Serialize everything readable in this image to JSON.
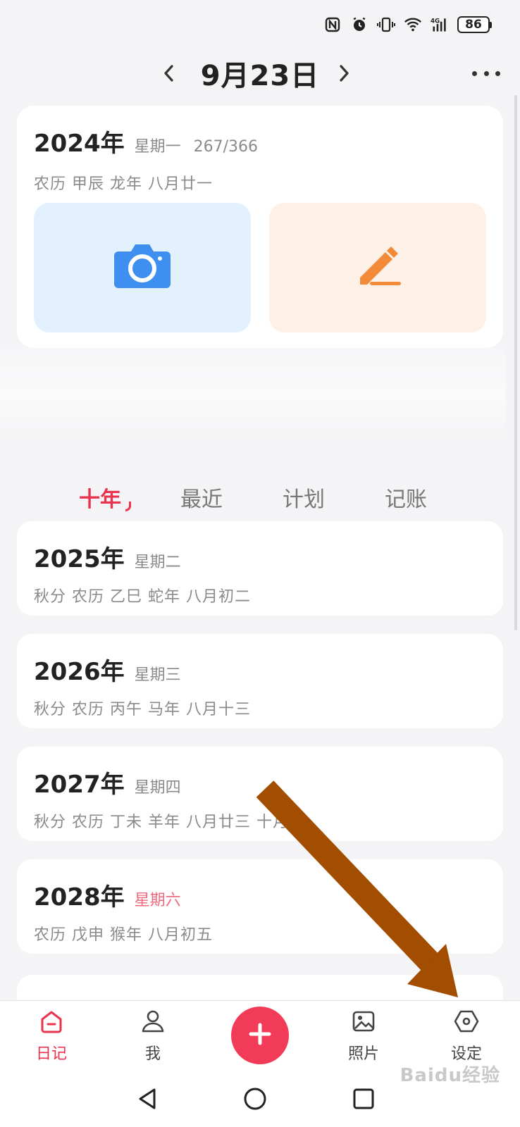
{
  "status_bar": {
    "battery": "86",
    "icons": [
      "nfc-icon",
      "alarm-icon",
      "vibrate-icon",
      "wifi-icon",
      "4g-signal-icon"
    ]
  },
  "header": {
    "title": "9月23日",
    "prev_icon": "chevron-left-icon",
    "next_icon": "chevron-right-icon",
    "more_icon": "more-dots-icon"
  },
  "today": {
    "year": "2024年",
    "weekday": "星期一",
    "day_count": "267/366",
    "lunar": "农历  甲辰 龙年 八月廿一",
    "camera_icon": "camera-icon",
    "write_icon": "pencil-icon"
  },
  "tabs": [
    {
      "label": "十年",
      "active": true
    },
    {
      "label": "最近",
      "active": false
    },
    {
      "label": "计划",
      "active": false
    },
    {
      "label": "记账",
      "active": false
    }
  ],
  "years": [
    {
      "year": "2025年",
      "weekday": "星期二",
      "lunar": "秋分 农历  乙巳 蛇年 八月初二",
      "weekend": false
    },
    {
      "year": "2026年",
      "weekday": "星期三",
      "lunar": "秋分 农历  丙午 马年 八月十三",
      "weekend": false
    },
    {
      "year": "2027年",
      "weekday": "星期四",
      "lunar": "秋分 农历  丁未 羊年 八月廿三  十月",
      "weekend": false
    },
    {
      "year": "2028年",
      "weekday": "星期六",
      "lunar": "农历  戊申 猴年 八月初五",
      "weekend": true
    }
  ],
  "bottom_nav": {
    "diary": "日记",
    "me": "我",
    "add": "+",
    "photos": "照片",
    "settings": "设定"
  },
  "colors": {
    "accent": "#e8344e",
    "fab": "#f23b58",
    "camera_tile": "#e2f1fd",
    "write_tile": "#fdf1e7",
    "arrow": "#a24d00"
  },
  "watermark": "Baidu经验"
}
